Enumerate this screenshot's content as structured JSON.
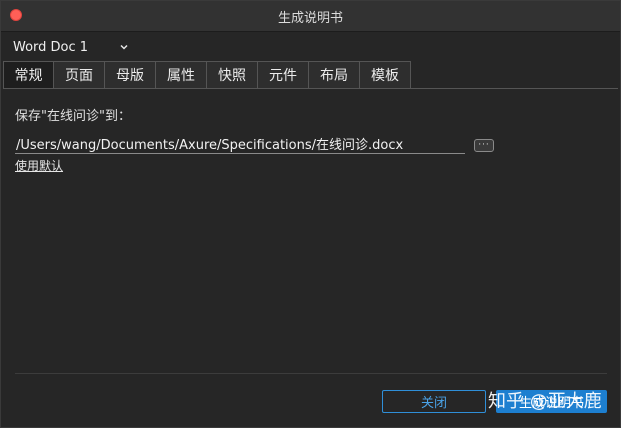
{
  "window": {
    "title": "生成说明书"
  },
  "doc_select": {
    "value": "Word Doc 1"
  },
  "tabs": [
    {
      "label": "常规"
    },
    {
      "label": "页面"
    },
    {
      "label": "母版"
    },
    {
      "label": "属性"
    },
    {
      "label": "快照"
    },
    {
      "label": "元件"
    },
    {
      "label": "布局"
    },
    {
      "label": "模板"
    }
  ],
  "general": {
    "save_label": "保存\"在线问诊\"到：",
    "path_value": "/Users/wang/Documents/Axure/Specifications/在线问诊.docx",
    "browse_label": "···",
    "use_default_label": "使用默认"
  },
  "footer": {
    "close_label": "关闭",
    "generate_label": "生成说明书"
  },
  "watermark": {
    "text": "知乎 @亚大鹿"
  },
  "colors": {
    "accent": "#1d7fd0",
    "close_dot": "#ff5f57",
    "background": "#262626"
  }
}
